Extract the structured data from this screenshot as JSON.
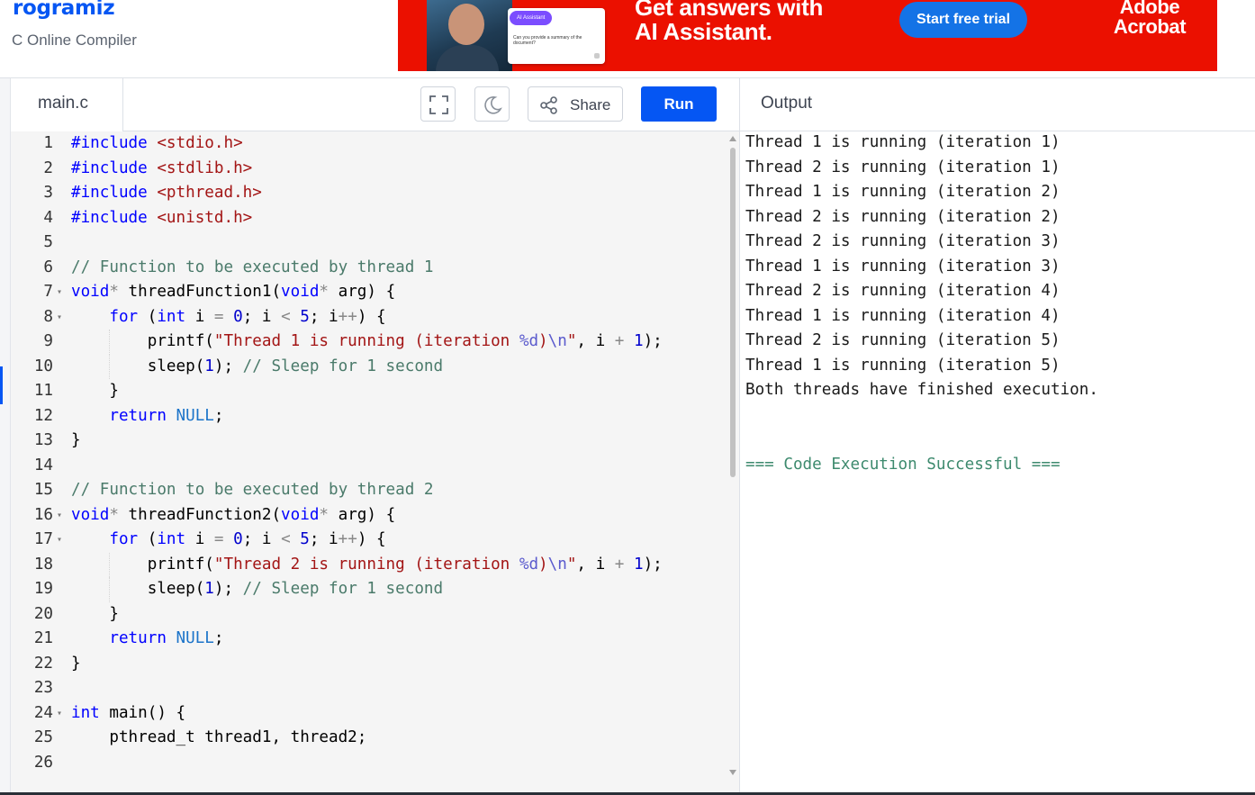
{
  "header": {
    "brand": "rogramiz",
    "subtitle": "C Online Compiler"
  },
  "ad": {
    "chip_label": "AI Assistant",
    "chat_prompt": "Can you provide a summary of the document?",
    "headline_line1": "Get answers with",
    "headline_line2": "AI Assistant.",
    "cta": "Start free trial",
    "brand_line1": "Adobe",
    "brand_line2": "Acrobat"
  },
  "editor": {
    "file_tab": "main.c",
    "share_label": "Share",
    "run_label": "Run",
    "fullscreen_icon": "fullscreen-icon",
    "theme_icon": "moon-icon",
    "share_icon": "share-icon"
  },
  "code_lines": [
    {
      "n": "1",
      "fold": false,
      "indent": 0,
      "tokens": [
        [
          "kw",
          "#include"
        ],
        [
          "",
          " "
        ],
        [
          "str",
          "<stdio.h>"
        ]
      ]
    },
    {
      "n": "2",
      "fold": false,
      "indent": 0,
      "tokens": [
        [
          "kw",
          "#include"
        ],
        [
          "",
          " "
        ],
        [
          "str",
          "<stdlib.h>"
        ]
      ]
    },
    {
      "n": "3",
      "fold": false,
      "indent": 0,
      "tokens": [
        [
          "kw",
          "#include"
        ],
        [
          "",
          " "
        ],
        [
          "str",
          "<pthread.h>"
        ]
      ]
    },
    {
      "n": "4",
      "fold": false,
      "indent": 0,
      "tokens": [
        [
          "kw",
          "#include"
        ],
        [
          "",
          " "
        ],
        [
          "str",
          "<unistd.h>"
        ]
      ]
    },
    {
      "n": "5",
      "fold": false,
      "indent": 0,
      "tokens": []
    },
    {
      "n": "6",
      "fold": false,
      "indent": 0,
      "tokens": [
        [
          "cm",
          "// Function to be executed by thread 1"
        ]
      ]
    },
    {
      "n": "7",
      "fold": true,
      "indent": 0,
      "tokens": [
        [
          "kw",
          "void"
        ],
        [
          "op",
          "*"
        ],
        [
          "",
          " threadFunction1("
        ],
        [
          "kw",
          "void"
        ],
        [
          "op",
          "*"
        ],
        [
          "",
          " arg) {"
        ]
      ]
    },
    {
      "n": "8",
      "fold": true,
      "indent": 1,
      "tokens": [
        [
          "",
          "    "
        ],
        [
          "kw",
          "for"
        ],
        [
          "",
          " ("
        ],
        [
          "kw",
          "int"
        ],
        [
          "",
          " i "
        ],
        [
          "op",
          "="
        ],
        [
          "",
          " "
        ],
        [
          "num",
          "0"
        ],
        [
          "",
          "; i "
        ],
        [
          "op",
          "<"
        ],
        [
          "",
          " "
        ],
        [
          "num",
          "5"
        ],
        [
          "",
          "; i"
        ],
        [
          "op",
          "++"
        ],
        [
          "",
          ") {"
        ]
      ]
    },
    {
      "n": "9",
      "fold": false,
      "indent": 2,
      "tokens": [
        [
          "",
          "        printf("
        ],
        [
          "str",
          "\"Thread 1 is running (iteration "
        ],
        [
          "esc",
          "%d"
        ],
        [
          "str",
          ")"
        ],
        [
          "esc",
          "\\n"
        ],
        [
          "str",
          "\""
        ],
        [
          "",
          ", i "
        ],
        [
          "op",
          "+"
        ],
        [
          "",
          " "
        ],
        [
          "num",
          "1"
        ],
        [
          "",
          ");"
        ]
      ]
    },
    {
      "n": "10",
      "fold": false,
      "indent": 2,
      "tokens": [
        [
          "",
          "        sleep("
        ],
        [
          "num",
          "1"
        ],
        [
          "",
          "); "
        ],
        [
          "cm",
          "// Sleep for 1 second"
        ]
      ]
    },
    {
      "n": "11",
      "fold": false,
      "indent": 1,
      "tokens": [
        [
          "",
          "    }"
        ]
      ]
    },
    {
      "n": "12",
      "fold": false,
      "indent": 1,
      "tokens": [
        [
          "",
          "    "
        ],
        [
          "kw",
          "return"
        ],
        [
          "",
          " "
        ],
        [
          "null",
          "NULL"
        ],
        [
          "",
          ";"
        ]
      ]
    },
    {
      "n": "13",
      "fold": false,
      "indent": 0,
      "tokens": [
        [
          "",
          "}"
        ]
      ]
    },
    {
      "n": "14",
      "fold": false,
      "indent": 0,
      "tokens": []
    },
    {
      "n": "15",
      "fold": false,
      "indent": 0,
      "tokens": [
        [
          "cm",
          "// Function to be executed by thread 2"
        ]
      ]
    },
    {
      "n": "16",
      "fold": true,
      "indent": 0,
      "tokens": [
        [
          "kw",
          "void"
        ],
        [
          "op",
          "*"
        ],
        [
          "",
          " threadFunction2("
        ],
        [
          "kw",
          "void"
        ],
        [
          "op",
          "*"
        ],
        [
          "",
          " arg) {"
        ]
      ]
    },
    {
      "n": "17",
      "fold": true,
      "indent": 1,
      "tokens": [
        [
          "",
          "    "
        ],
        [
          "kw",
          "for"
        ],
        [
          "",
          " ("
        ],
        [
          "kw",
          "int"
        ],
        [
          "",
          " i "
        ],
        [
          "op",
          "="
        ],
        [
          "",
          " "
        ],
        [
          "num",
          "0"
        ],
        [
          "",
          "; i "
        ],
        [
          "op",
          "<"
        ],
        [
          "",
          " "
        ],
        [
          "num",
          "5"
        ],
        [
          "",
          "; i"
        ],
        [
          "op",
          "++"
        ],
        [
          "",
          ") {"
        ]
      ]
    },
    {
      "n": "18",
      "fold": false,
      "indent": 2,
      "tokens": [
        [
          "",
          "        printf("
        ],
        [
          "str",
          "\"Thread 2 is running (iteration "
        ],
        [
          "esc",
          "%d"
        ],
        [
          "str",
          ")"
        ],
        [
          "esc",
          "\\n"
        ],
        [
          "str",
          "\""
        ],
        [
          "",
          ", i "
        ],
        [
          "op",
          "+"
        ],
        [
          "",
          " "
        ],
        [
          "num",
          "1"
        ],
        [
          "",
          ");"
        ]
      ]
    },
    {
      "n": "19",
      "fold": false,
      "indent": 2,
      "tokens": [
        [
          "",
          "        sleep("
        ],
        [
          "num",
          "1"
        ],
        [
          "",
          "); "
        ],
        [
          "cm",
          "// Sleep for 1 second"
        ]
      ]
    },
    {
      "n": "20",
      "fold": false,
      "indent": 1,
      "tokens": [
        [
          "",
          "    }"
        ]
      ]
    },
    {
      "n": "21",
      "fold": false,
      "indent": 1,
      "tokens": [
        [
          "",
          "    "
        ],
        [
          "kw",
          "return"
        ],
        [
          "",
          " "
        ],
        [
          "null",
          "NULL"
        ],
        [
          "",
          ";"
        ]
      ]
    },
    {
      "n": "22",
      "fold": false,
      "indent": 0,
      "tokens": [
        [
          "",
          "}"
        ]
      ]
    },
    {
      "n": "23",
      "fold": false,
      "indent": 0,
      "tokens": []
    },
    {
      "n": "24",
      "fold": true,
      "indent": 0,
      "tokens": [
        [
          "kw",
          "int"
        ],
        [
          "",
          " main() {"
        ]
      ]
    },
    {
      "n": "25",
      "fold": false,
      "indent": 1,
      "tokens": [
        [
          "",
          "    pthread_t thread1, thread2;"
        ]
      ]
    },
    {
      "n": "26",
      "fold": false,
      "indent": 0,
      "tokens": []
    }
  ],
  "output": {
    "title": "Output",
    "lines": [
      "Thread 1 is running (iteration 1)",
      "Thread 2 is running (iteration 1)",
      "Thread 1 is running (iteration 2)",
      "Thread 2 is running (iteration 2)",
      "Thread 2 is running (iteration 3)",
      "Thread 1 is running (iteration 3)",
      "Thread 2 is running (iteration 4)",
      "Thread 1 is running (iteration 4)",
      "Thread 2 is running (iteration 5)",
      "Thread 1 is running (iteration 5)",
      "Both threads have finished execution.",
      "",
      "",
      "=== Code Execution Successful ==="
    ]
  },
  "colors": {
    "accent": "#0556f3",
    "ad_red": "#eb1000",
    "keyword": "#0000ff",
    "string": "#a31515",
    "comment": "#4a7a6a",
    "success": "#3d8a6e"
  }
}
